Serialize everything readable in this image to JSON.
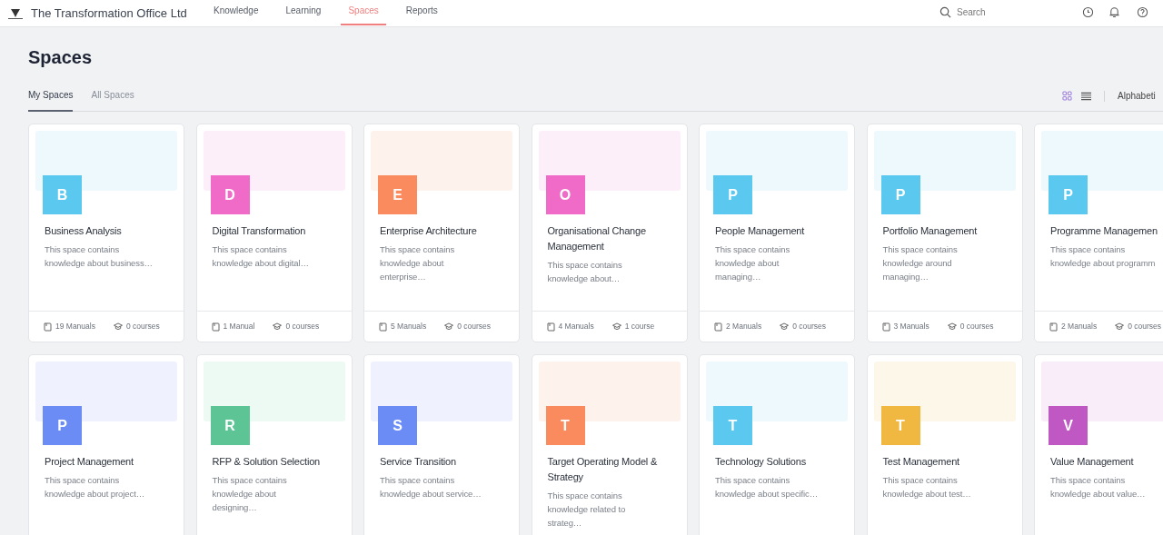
{
  "header": {
    "company": "The Transformation Office Ltd",
    "nav": [
      {
        "label": "Knowledge",
        "selected": false
      },
      {
        "label": "Learning",
        "selected": false
      },
      {
        "label": "Spaces",
        "selected": true
      },
      {
        "label": "Reports",
        "selected": false
      }
    ],
    "search": {
      "placeholder": "Search"
    }
  },
  "page": {
    "title": "Spaces",
    "tabs": [
      {
        "label": "My Spaces",
        "selected": true
      },
      {
        "label": "All Spaces",
        "selected": false
      }
    ],
    "view_modes": [
      {
        "kind": "grid",
        "selected": true
      },
      {
        "kind": "list",
        "selected": false
      }
    ],
    "sort": "Alphabeti"
  },
  "rows": [
    [
      {
        "letter": "B",
        "color": "#5bc8f0",
        "title": "Business Analysis",
        "description": "This space contains knowledge about business…",
        "manuals": "19 Manuals",
        "courses": "0 courses"
      },
      {
        "letter": "D",
        "color": "#f06bc8",
        "title": "Digital Transformation",
        "description": "This space contains knowledge about digital…",
        "manuals": "1 Manual",
        "courses": "0 courses"
      },
      {
        "letter": "E",
        "color": "#f98b5e",
        "title": "Enterprise Architecture",
        "description": "This space contains knowledge about enterprise…",
        "manuals": "5 Manuals",
        "courses": "0 courses"
      },
      {
        "letter": "O",
        "color": "#f06bc8",
        "title": "Organisational Change Management",
        "description": "This space contains knowledge about…",
        "manuals": "4 Manuals",
        "courses": "1 course"
      },
      {
        "letter": "P",
        "color": "#5bc8f0",
        "title": "People Management",
        "description": "This space contains knowledge about managing…",
        "manuals": "2 Manuals",
        "courses": "0 courses"
      },
      {
        "letter": "P",
        "color": "#5bc8f0",
        "title": "Portfolio Management",
        "description": "This space contains knowledge around managing…",
        "manuals": "3 Manuals",
        "courses": "0 courses"
      },
      {
        "letter": "P",
        "color": "#5bc8f0",
        "title": "Programme Managemen",
        "description": "This space contains knowledge about programm",
        "manuals": "2 Manuals",
        "courses": "0 courses"
      }
    ],
    [
      {
        "letter": "P",
        "color": "#6b8cf5",
        "title": "Project Management",
        "description": "This space contains knowledge about project…"
      },
      {
        "letter": "R",
        "color": "#5cc495",
        "title": "RFP & Solution Selection",
        "description": "This space contains knowledge about designing…"
      },
      {
        "letter": "S",
        "color": "#6b8cf5",
        "title": "Service Transition",
        "description": "This space contains knowledge about service…"
      },
      {
        "letter": "T",
        "color": "#f98b5e",
        "title": "Target Operating Model & Strategy",
        "description": "This space contains knowledge related to strateg…"
      },
      {
        "letter": "T",
        "color": "#5bc8f0",
        "title": "Technology Solutions",
        "description": "This space contains knowledge about specific…"
      },
      {
        "letter": "T",
        "color": "#f0b840",
        "title": "Test Management",
        "description": "This space contains knowledge about test…"
      },
      {
        "letter": "V",
        "color": "#c058c4",
        "title": "Value Management",
        "description": "This space contains knowledge about value…"
      }
    ]
  ]
}
